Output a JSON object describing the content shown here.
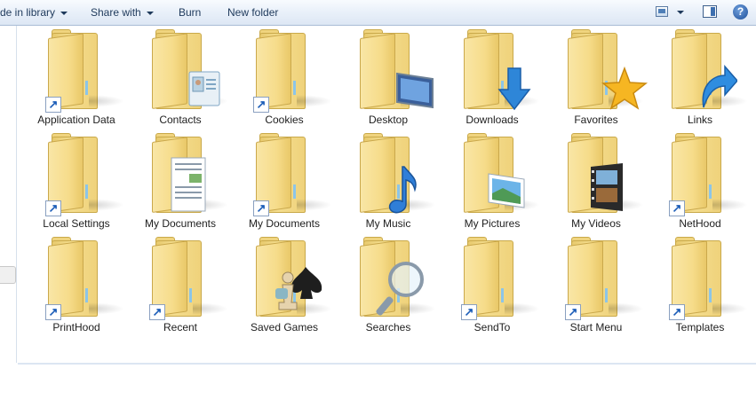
{
  "toolbar": {
    "include_library_label": "de in library",
    "share_with_label": "Share with",
    "burn_label": "Burn",
    "new_folder_label": "New folder",
    "help_glyph": "?"
  },
  "colors": {
    "toolbar_text": "#1e395b",
    "folder_body": "#f6dc8a",
    "folder_edge": "#caa84c",
    "shortcut_arrow": "#1c5db8"
  },
  "items": [
    {
      "label": "Application Data",
      "icon": "shortcut-folder-icon",
      "shortcut": true
    },
    {
      "label": "Contacts",
      "icon": "contacts-folder-icon",
      "shortcut": false
    },
    {
      "label": "Cookies",
      "icon": "shortcut-folder-icon",
      "shortcut": true
    },
    {
      "label": "Desktop",
      "icon": "desktop-folder-icon",
      "shortcut": false
    },
    {
      "label": "Downloads",
      "icon": "downloads-folder-icon",
      "shortcut": false
    },
    {
      "label": "Favorites",
      "icon": "favorites-folder-icon",
      "shortcut": false
    },
    {
      "label": "Links",
      "icon": "links-folder-icon",
      "shortcut": false
    },
    {
      "label": "Local Settings",
      "icon": "shortcut-folder-icon",
      "shortcut": true
    },
    {
      "label": "My Documents",
      "icon": "documents-folder-icon",
      "shortcut": false
    },
    {
      "label": "My Documents",
      "icon": "shortcut-folder-icon",
      "shortcut": true
    },
    {
      "label": "My Music",
      "icon": "music-folder-icon",
      "shortcut": false
    },
    {
      "label": "My Pictures",
      "icon": "pictures-folder-icon",
      "shortcut": false
    },
    {
      "label": "My Videos",
      "icon": "videos-folder-icon",
      "shortcut": false
    },
    {
      "label": "NetHood",
      "icon": "shortcut-folder-icon",
      "shortcut": true
    },
    {
      "label": "PrintHood",
      "icon": "shortcut-folder-icon",
      "shortcut": true
    },
    {
      "label": "Recent",
      "icon": "shortcut-folder-icon",
      "shortcut": true
    },
    {
      "label": "Saved Games",
      "icon": "saved-games-folder-icon",
      "shortcut": false
    },
    {
      "label": "Searches",
      "icon": "searches-folder-icon",
      "shortcut": false
    },
    {
      "label": "SendTo",
      "icon": "shortcut-folder-icon",
      "shortcut": true
    },
    {
      "label": "Start Menu",
      "icon": "shortcut-folder-icon",
      "shortcut": true
    },
    {
      "label": "Templates",
      "icon": "shortcut-folder-icon",
      "shortcut": true
    }
  ]
}
